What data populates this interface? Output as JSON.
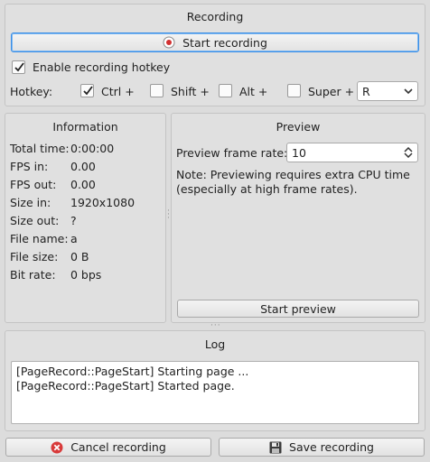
{
  "recording": {
    "title": "Recording",
    "start_button": "Start recording",
    "enable_hotkey_label": "Enable recording hotkey",
    "enable_hotkey_checked": true,
    "hotkey_label": "Hotkey:",
    "modifiers": [
      {
        "label": "Ctrl +",
        "checked": true
      },
      {
        "label": "Shift +",
        "checked": false
      },
      {
        "label": "Alt +",
        "checked": false
      },
      {
        "label": "Super +",
        "checked": false
      }
    ],
    "key_value": "R"
  },
  "information": {
    "title": "Information",
    "rows": [
      {
        "key": "Total time:",
        "value": "0:00:00"
      },
      {
        "key": "FPS in:",
        "value": "0.00"
      },
      {
        "key": "FPS out:",
        "value": "0.00"
      },
      {
        "key": "Size in:",
        "value": "1920x1080"
      },
      {
        "key": "Size out:",
        "value": "?"
      },
      {
        "key": "File name:",
        "value": "a"
      },
      {
        "key": "File size:",
        "value": "0 B"
      },
      {
        "key": "Bit rate:",
        "value": "0 bps"
      }
    ]
  },
  "preview": {
    "title": "Preview",
    "frame_rate_label": "Preview frame rate:",
    "frame_rate_value": "10",
    "note_line1": "Note: Previewing requires extra CPU time",
    "note_line2": "(especially at high frame rates).",
    "start_button": "Start preview"
  },
  "log": {
    "title": "Log",
    "lines": [
      "[PageRecord::PageStart] Starting page ...",
      "[PageRecord::PageStart] Started page."
    ]
  },
  "footer": {
    "cancel_button": "Cancel recording",
    "save_button": "Save recording"
  },
  "colors": {
    "record_icon": "#d23030",
    "cancel_icon": "#d83a3a",
    "focus_border": "#3a8ee6"
  }
}
